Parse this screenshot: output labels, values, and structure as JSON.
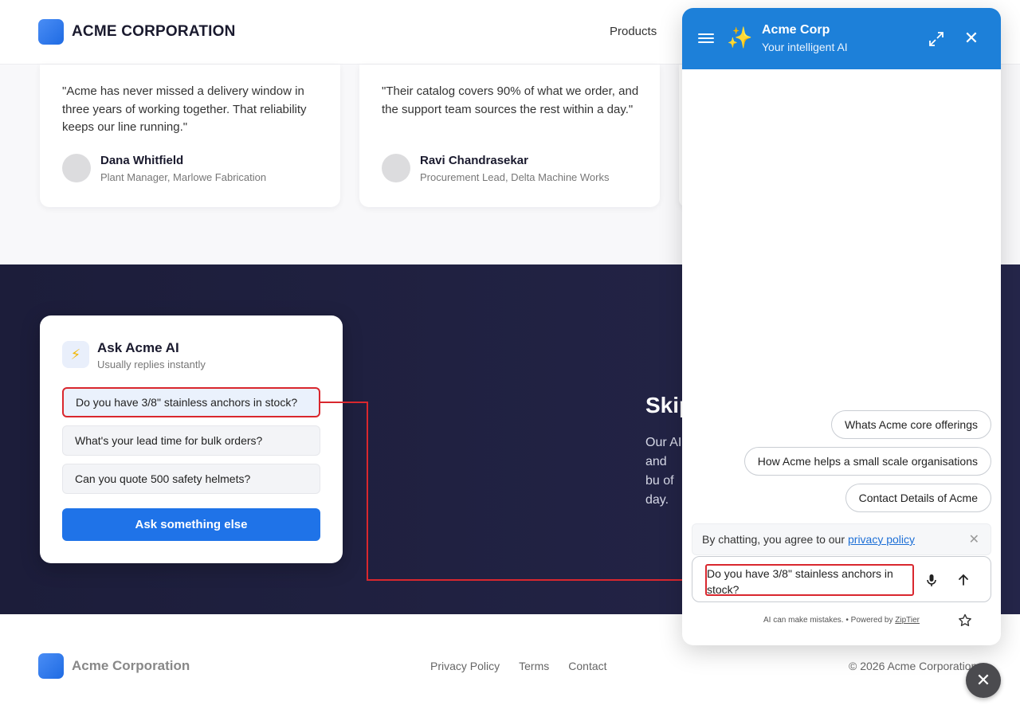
{
  "header": {
    "brand": "ACME CORPORATION",
    "nav_products": "Products"
  },
  "testimonials": [
    {
      "quote": "\"Acme has never missed a delivery window in three years of working together. That reliability keeps our line running.\"",
      "name": "Dana Whitfield",
      "role": "Plant Manager, Marlowe Fabrication"
    },
    {
      "quote": "\"Their catalog covers 90% of what we order, and the support team sources the rest within a day.\"",
      "name": "Ravi Chandrasekar",
      "role": "Procurement Lead, Delta Machine Works"
    }
  ],
  "ask_card": {
    "icon": "lightning-icon",
    "title": "Ask Acme AI",
    "subtitle": "Usually replies instantly",
    "questions": [
      "Do you have 3/8\" stainless anchors in stock?",
      "What's your lead time for bulk orders?",
      "Can you quote 500 safety helmets?"
    ],
    "cta": "Ask something else"
  },
  "promo": {
    "heading": "Skip",
    "body": "Our AI and bu of day."
  },
  "footer": {
    "brand": "Acme Corporation",
    "links": [
      "Privacy Policy",
      "Terms",
      "Contact"
    ],
    "copyright": "© 2026 Acme Corporation"
  },
  "chat": {
    "title": "Acme Corp",
    "subtitle": "Your intelligent AI",
    "suggestions": [
      "Whats Acme core offerings",
      "How Acme helps a small scale organisations",
      "Contact Details of Acme"
    ],
    "privacy_text": "By chatting, you agree to our",
    "privacy_link": "privacy policy",
    "composer_value": "Do you have 3/8\" stainless anchors in stock?",
    "disclaimer": "AI can make mistakes.",
    "separator": "•",
    "powered_by": "Powered by",
    "powered_name": "ZipTier"
  },
  "colors": {
    "accent": "#1f73e8",
    "chat_header": "#1d80d9",
    "annotation": "#d9272e",
    "dark_section": "#1c1d3a"
  }
}
